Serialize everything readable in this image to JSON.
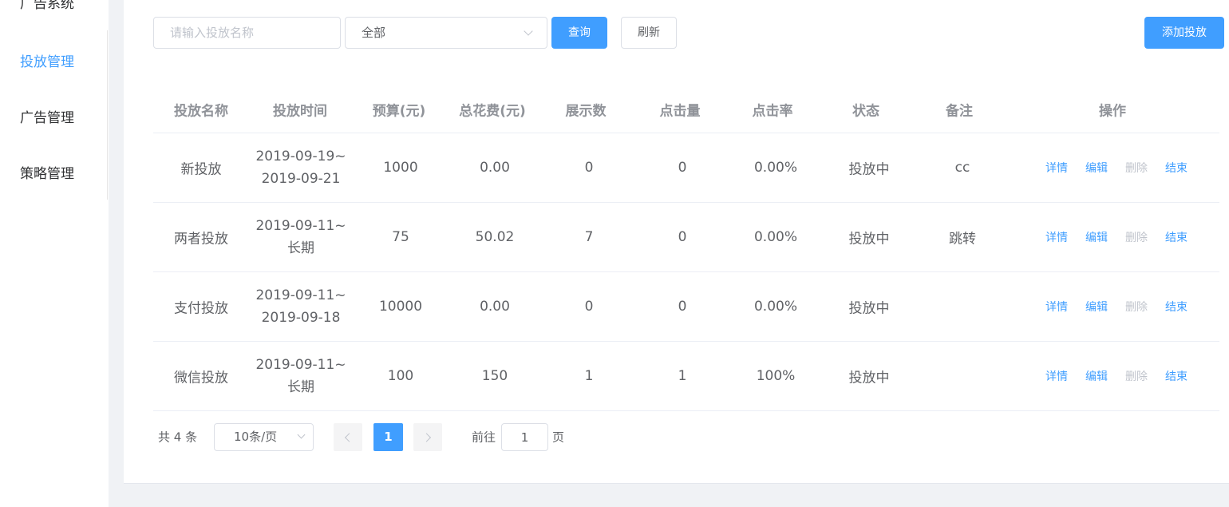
{
  "sidebar": {
    "items": [
      {
        "label": "广告系统"
      },
      {
        "label": "投放管理",
        "active": true
      },
      {
        "label": "广告管理"
      },
      {
        "label": "策略管理"
      }
    ]
  },
  "toolbar": {
    "search_placeholder": "请输入投放名称",
    "status_select_value": "全部",
    "query_label": "查询",
    "refresh_label": "刷新",
    "add_label": "添加投放"
  },
  "table": {
    "headers": [
      "投放名称",
      "投放时间",
      "预算(元)",
      "总花费(元)",
      "展示数",
      "点击量",
      "点击率",
      "状态",
      "备注",
      "操作"
    ],
    "rows": [
      {
        "name": "新投放",
        "time_start": "2019-09-19~",
        "time_end": "2019-09-21",
        "budget": "1000",
        "cost": "0.00",
        "impressions": "0",
        "clicks": "0",
        "ctr": "0.00%",
        "status": "投放中",
        "remark": "cc"
      },
      {
        "name": "两者投放",
        "time_start": "2019-09-11~",
        "time_end": "长期",
        "budget": "75",
        "cost": "50.02",
        "impressions": "7",
        "clicks": "0",
        "ctr": "0.00%",
        "status": "投放中",
        "remark": "跳转"
      },
      {
        "name": "支付投放",
        "time_start": "2019-09-11~",
        "time_end": "2019-09-18",
        "budget": "10000",
        "cost": "0.00",
        "impressions": "0",
        "clicks": "0",
        "ctr": "0.00%",
        "status": "投放中",
        "remark": ""
      },
      {
        "name": "微信投放",
        "time_start": "2019-09-11~",
        "time_end": "长期",
        "budget": "100",
        "cost": "150",
        "impressions": "1",
        "clicks": "1",
        "ctr": "100%",
        "status": "投放中",
        "remark": ""
      }
    ],
    "actions": {
      "detail": "详情",
      "edit": "编辑",
      "delete": "删除",
      "end": "结束"
    }
  },
  "pagination": {
    "total": "共 4 条",
    "page_size": "10条/页",
    "current_page": "1",
    "goto_prefix": "前往",
    "goto_value": "1",
    "goto_suffix": "页"
  },
  "colors": {
    "primary": "#409eff",
    "text": "#606266",
    "header_text": "#909399",
    "disabled": "#c0c4cc",
    "background": "#f0f2f5"
  }
}
